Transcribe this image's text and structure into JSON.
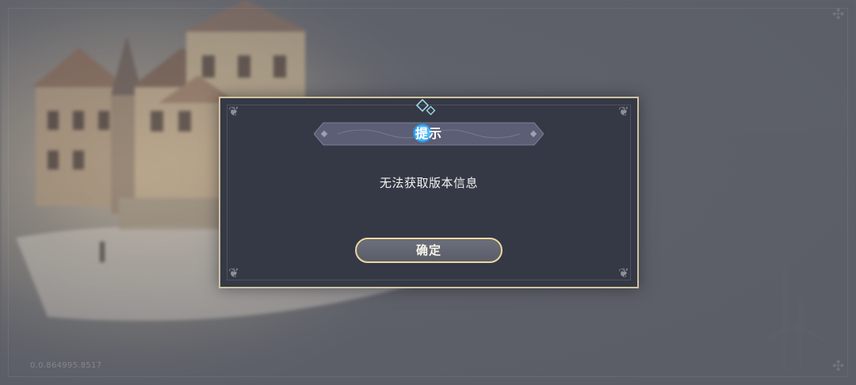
{
  "dialog": {
    "title": "提示",
    "message": "无法获取版本信息",
    "confirm_label": "确定"
  },
  "footer": {
    "version": "0.0.864995.8517"
  },
  "colors": {
    "dialog_bg": "#353945",
    "dialog_border": "#cfc3a0",
    "button_border": "#e6d7ae",
    "title_gem": "#3fa7e8"
  },
  "icons": {
    "title_gem": "crystal-icon",
    "corners": "ornament-icon"
  }
}
